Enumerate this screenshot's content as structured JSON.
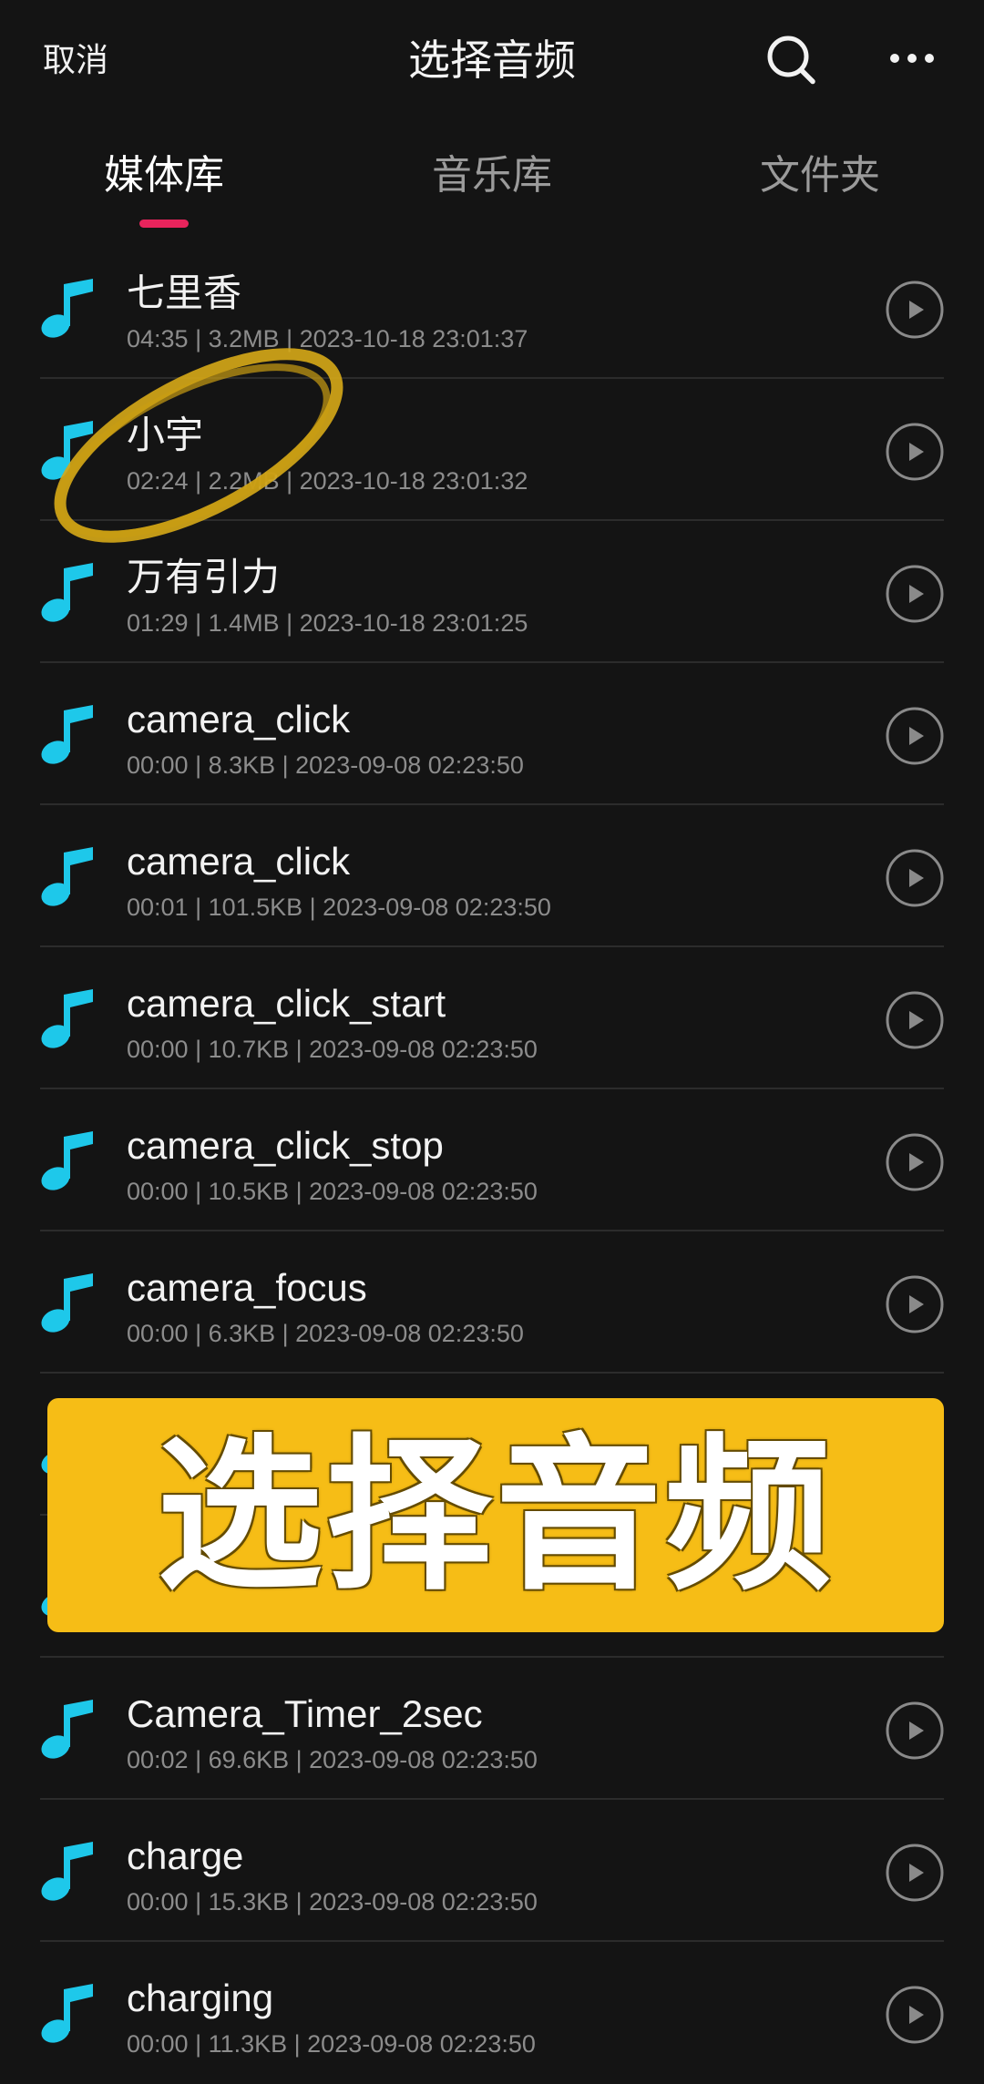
{
  "header": {
    "cancel_label": "取消",
    "title": "选择音频",
    "search_icon": "search-icon",
    "more_icon": "more-icon"
  },
  "tabs": [
    {
      "label": "媒体库",
      "active": true
    },
    {
      "label": "音乐库",
      "active": false
    },
    {
      "label": "文件夹",
      "active": false
    }
  ],
  "colors": {
    "background": "#141414",
    "accent": "#e8245c",
    "music_icon": "#1ec8ea",
    "secondary_text": "#8c8c8c",
    "highlight_marker": "#d6a817",
    "banner": "#f6bd16"
  },
  "tracks": [
    {
      "title": "七里香",
      "meta": "04:35 | 3.2MB | 2023-10-18 23:01:37"
    },
    {
      "title": "小宇",
      "meta": "02:24 | 2.2MB | 2023-10-18 23:01:32",
      "circled": true
    },
    {
      "title": "万有引力",
      "meta": "01:29 | 1.4MB | 2023-10-18 23:01:25"
    },
    {
      "title": "camera_click",
      "meta": "00:00 | 8.3KB | 2023-09-08 02:23:50"
    },
    {
      "title": "camera_click",
      "meta": "00:01 | 101.5KB | 2023-09-08 02:23:50"
    },
    {
      "title": "camera_click_start",
      "meta": "00:00 | 10.7KB | 2023-09-08 02:23:50"
    },
    {
      "title": "camera_click_stop",
      "meta": "00:00 | 10.5KB | 2023-09-08 02:23:50"
    },
    {
      "title": "camera_focus",
      "meta": "00:00 | 6.3KB | 2023-09-08 02:23:50"
    },
    {
      "covered": true
    },
    {
      "covered": true
    },
    {
      "title": "Camera_Timer_2sec",
      "meta": "00:02 | 69.6KB | 2023-09-08 02:23:50"
    },
    {
      "title": "charge",
      "meta": "00:00 | 15.3KB | 2023-09-08 02:23:50"
    },
    {
      "title": "charging",
      "meta": "00:00 | 11.3KB | 2023-09-08 02:23:50"
    }
  ],
  "overlay_banner": {
    "text": "选择音频"
  }
}
